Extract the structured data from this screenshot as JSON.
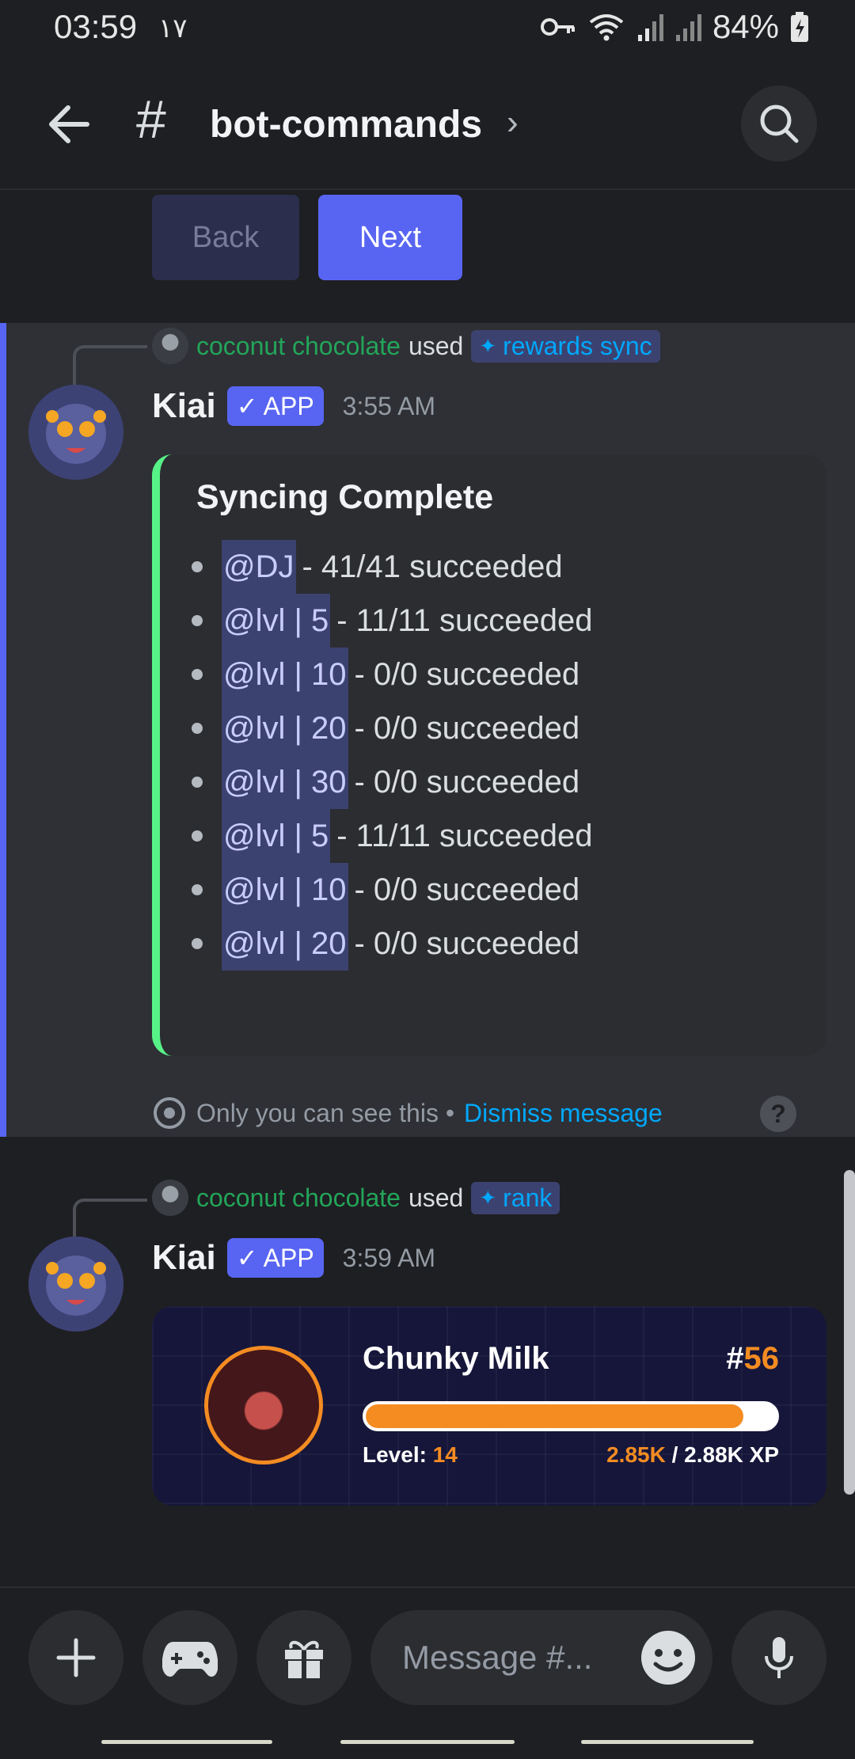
{
  "status": {
    "time": "03:59",
    "extra": "١٧",
    "battery": "84%"
  },
  "header": {
    "channel": "bot-commands"
  },
  "pager": {
    "back_label": "Back",
    "next_label": "Next"
  },
  "messages": [
    {
      "user": "coconut chocolate",
      "used": "used",
      "command": "rewards sync",
      "author": "Kiai",
      "badge": "✓ APP",
      "time": "3:55 AM",
      "embed": {
        "title": "Syncing Complete",
        "items": [
          {
            "role": "@DJ",
            "result": "- 41/41 succeeded"
          },
          {
            "role": "@lvl | 5",
            "result": "- 11/11 succeeded"
          },
          {
            "role": "@lvl | 10",
            "result": "- 0/0 succeeded"
          },
          {
            "role": "@lvl | 20",
            "result": "- 0/0 succeeded"
          },
          {
            "role": "@lvl | 30",
            "result": "- 0/0 succeeded"
          },
          {
            "role": "@lvl | 5",
            "result": "- 11/11 succeeded"
          },
          {
            "role": "@lvl | 10",
            "result": "- 0/0 succeeded"
          },
          {
            "role": "@lvl | 20",
            "result": "- 0/0 succeeded"
          }
        ]
      },
      "ephemeral_note": "Only you can see this •",
      "dismiss": "Dismiss message"
    },
    {
      "user": "coconut chocolate",
      "used": "used",
      "command": "rank",
      "author": "Kiai",
      "badge": "✓ APP",
      "time": "3:59 AM",
      "rank_card": {
        "name": "Chunky Milk",
        "rank_hash": "#",
        "rank": "56",
        "level_label": "Level:",
        "level": "14",
        "xp_current": "2.85K",
        "xp_total": "/ 2.88K XP",
        "progress_fraction": 0.92
      }
    }
  ],
  "composer": {
    "placeholder": "Message #..."
  },
  "colors": {
    "accent": "#5865f2",
    "success": "#57f287",
    "xp_orange": "#f48c22",
    "username_green": "#23a559",
    "link": "#00a8fc"
  }
}
